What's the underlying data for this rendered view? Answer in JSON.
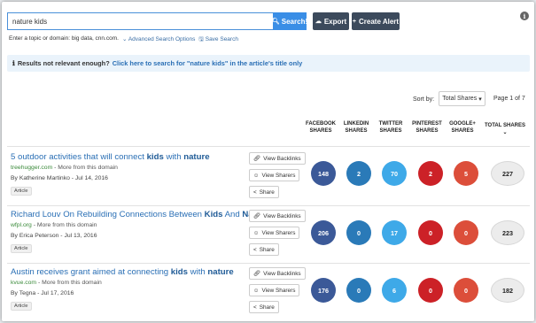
{
  "search": {
    "value": "nature kids",
    "button_label": "Search!",
    "hint": "Enter a topic or domain: big data, cnn.com.",
    "advanced_label": "Advanced Search Options",
    "save_label": "Save Search"
  },
  "toolbar": {
    "export_label": "Export",
    "create_alert_label": "Create Alert"
  },
  "notice": {
    "prefix": "Results not relevant enough?",
    "link": "Click here to search for \"nature kids\" in the article's title only"
  },
  "sort": {
    "label": "Sort by:",
    "value": "Total Shares",
    "page_info": "Page 1 of 7"
  },
  "columns": {
    "facebook": [
      "FACEBOOK",
      "SHARES"
    ],
    "linkedin": [
      "LINKEDIN",
      "SHARES"
    ],
    "twitter": [
      "TWITTER",
      "SHARES"
    ],
    "pinterest": [
      "PINTEREST",
      "SHARES"
    ],
    "google": [
      "GOOGLE+",
      "SHARES"
    ],
    "total": "TOTAL SHARES"
  },
  "actions": {
    "backlinks": "View Backlinks",
    "sharers": "View Sharers",
    "share": "Share"
  },
  "colors": {
    "facebook": "#3b5998",
    "linkedin": "#2a7ab8",
    "twitter": "#3ea9e8",
    "pinterest": "#cc2127",
    "google": "#dc4e3a"
  },
  "results": [
    {
      "title_pre": "5 outdoor activities that will connect ",
      "title_kw1": "kids",
      "title_mid": " with ",
      "title_kw2": "nature",
      "title_post": "",
      "domain": "treehugger.com",
      "more": " - More from this domain",
      "author": "By Katherine Martinko - Jul 14, 2016",
      "tag": "Article",
      "facebook": "148",
      "linkedin": "2",
      "twitter": "70",
      "pinterest": "2",
      "google": "5",
      "total": "227"
    },
    {
      "title_pre": "Richard Louv On Rebuilding Connections Between ",
      "title_kw1": "Kids",
      "title_mid": " And ",
      "title_kw2": "Nature",
      "title_post": "",
      "domain": "wfpl.org",
      "more": " - More from this domain",
      "author": "By Erica Peterson - Jul 13, 2016",
      "tag": "Article",
      "facebook": "206",
      "linkedin": "0",
      "twitter": "17",
      "pinterest": "0",
      "google": "0",
      "total": "223"
    },
    {
      "title_pre": "Austin receives grant aimed at connecting ",
      "title_kw1": "kids",
      "title_mid": " with ",
      "title_kw2": "nature",
      "title_post": "",
      "domain": "kvue.com",
      "more": " - More from this domain",
      "author": "By Tegna - Jul 17, 2016",
      "tag": "Article",
      "facebook": "176",
      "linkedin": "0",
      "twitter": "6",
      "pinterest": "0",
      "google": "0",
      "total": "182"
    }
  ]
}
